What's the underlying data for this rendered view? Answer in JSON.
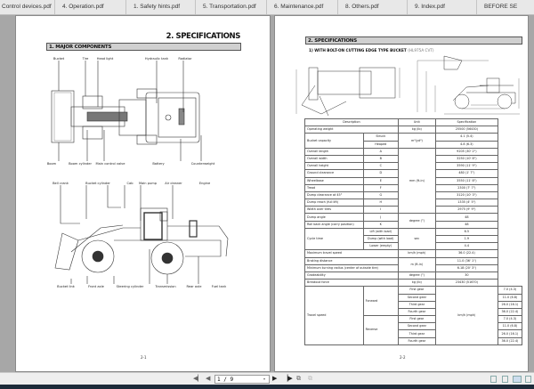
{
  "tabs": [
    "Control devices.pdf",
    "4. Operation.pdf",
    "1. Safety hints.pdf",
    "5. Transportation.pdf",
    "6. Maintenance.pdf",
    "8. Others.pdf",
    "9. Index.pdf",
    "BEFORE SE"
  ],
  "left_page": {
    "title": "2. SPECIFICATIONS",
    "section": "1. MAJOR COMPONENTS",
    "top_labels": [
      "Bucket",
      "Tire",
      "Head light",
      "Hydraulic tank",
      "Radiator"
    ],
    "top_bottom_labels": [
      "Boom",
      "Boom cylinder",
      "Main control valve",
      "Battery",
      "Counterweight"
    ],
    "side_labels": [
      "Bell crank",
      "Bucket cylinder",
      "Cab",
      "Main pump",
      "Air cleaner",
      "Engine"
    ],
    "side_bottom_labels": [
      "Bucket link",
      "Front axle",
      "Steering cylinder",
      "Transmission",
      "Rear axle",
      "Fuel tank"
    ],
    "page_number": "2-1"
  },
  "right_page": {
    "section": "2. SPECIFICATIONS",
    "subtitle": "1) WITH BOLT-ON CUTTING EDGE TYPE BUCKET",
    "model": "(HL975A CVT)",
    "page_number": "2-2",
    "table": {
      "headers": [
        "Description",
        "Unit",
        "Specification"
      ],
      "operating_weight": [
        "Operating weight",
        "kg (lb)",
        "25500 (56430)"
      ],
      "bucket": {
        "label": "Bucket capacity",
        "unit": "m³(yd³)",
        "rows": [
          [
            "Struck",
            "4.1 (5.4)"
          ],
          [
            "Heaped",
            "4.8 (6.3)"
          ]
        ]
      },
      "dims_unit": "mm (ft-in)",
      "dims": [
        [
          "Overall length",
          "A",
          "9205 (30' 2\")"
        ],
        [
          "Overall width",
          "B",
          "3250 (10' 8\")"
        ],
        [
          "Overall height",
          "C",
          "3590 (11' 9\")"
        ],
        [
          "Ground clearance",
          "D",
          "480 (1' 7\")"
        ],
        [
          "Wheelbase",
          "E",
          "3550 (11' 8\")"
        ],
        [
          "Tread",
          "F",
          "2300 (7' 7\")"
        ],
        [
          "Dump clearance at 45°",
          "G",
          "3120 (10' 3\")"
        ],
        [
          "Dump reach (full lift)",
          "H",
          "1335 (4' 5\")"
        ],
        [
          "Width over tires",
          "I",
          "2975 (9' 9\")"
        ]
      ],
      "angle_unit": "degree (°)",
      "angles": [
        [
          "Dump angle",
          "J",
          "48"
        ],
        [
          "Roll back angle (carry position)",
          "K",
          "48"
        ]
      ],
      "cycle": {
        "label": "Cycle time",
        "unit": "sec",
        "rows": [
          [
            "Lift (with load)",
            "6.5"
          ],
          [
            "Dump (with load)",
            "1.9"
          ],
          [
            "Lower (empty)",
            "4.4"
          ]
        ]
      },
      "max_speed": [
        "Maximum travel speed",
        "km/h (mph)",
        "36.0 (22.4)"
      ],
      "distance_unit": "m (ft-in)",
      "braking": [
        "Braking distance",
        "11.0 (36' 1\")"
      ],
      "turning": [
        "Minimum turning radius (center of outside tire)",
        "6.18 (20' 3\")"
      ],
      "gradeability": [
        "Gradeability",
        "degree (°)",
        "30"
      ],
      "breakout": [
        "Breakout force",
        "kg (lb)",
        "23430 (51670)"
      ],
      "travel": {
        "label": "Travel speed",
        "unit": "km/h (mph)",
        "groups": [
          {
            "name": "Forward",
            "rows": [
              [
                "First gear",
                "7.0 (4.3)"
              ],
              [
                "Second gear",
                "11.0 (6.8)"
              ],
              [
                "Third gear",
                "26.0 (16.1)"
              ],
              [
                "Fourth gear",
                "36.0 (22.4)"
              ]
            ]
          },
          {
            "name": "Reverse",
            "rows": [
              [
                "First gear",
                "7.0 (4.3)"
              ],
              [
                "Second gear",
                "11.0 (6.8)"
              ],
              [
                "Third gear",
                "26.0 (16.1)"
              ],
              [
                "Fourth gear",
                "36.0 (22.4)"
              ]
            ]
          }
        ]
      }
    }
  },
  "toolbar": {
    "page_value": "1 / 9"
  }
}
